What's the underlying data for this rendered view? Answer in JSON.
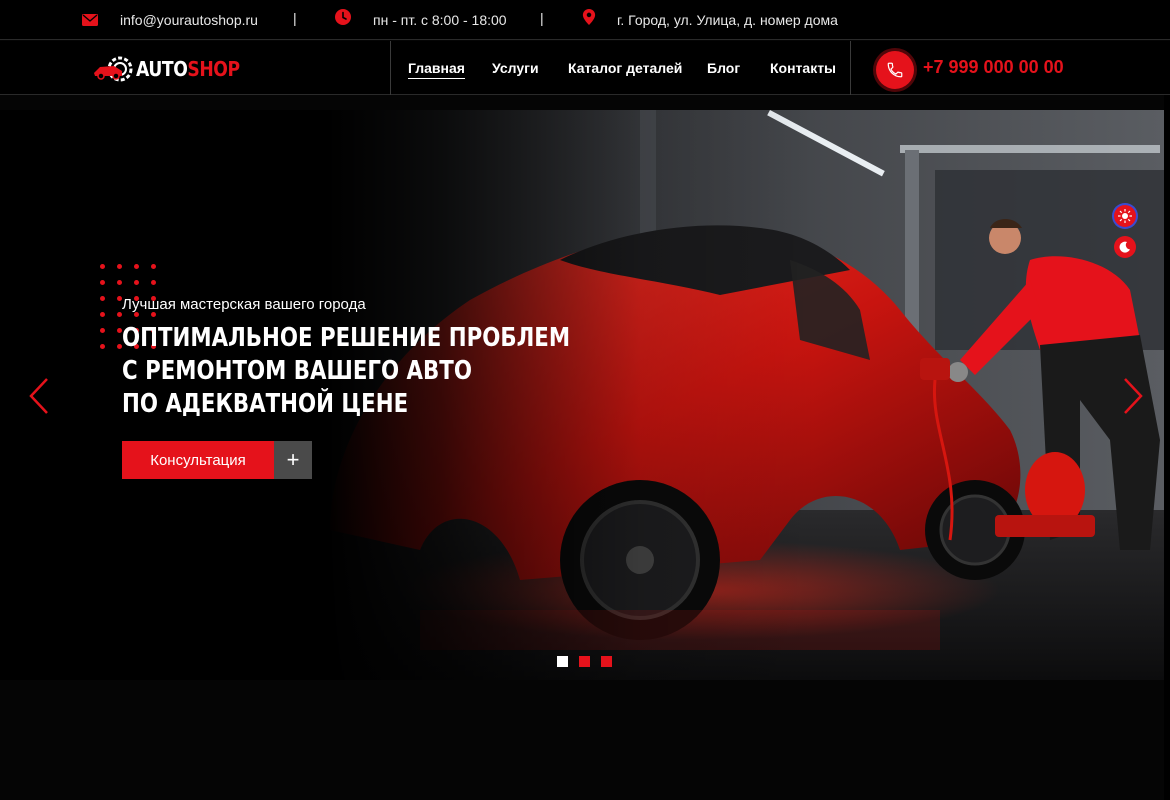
{
  "topbar": {
    "email": "info@yourautoshop.ru",
    "hours": "пн - пт. с 8:00 - 18:00",
    "address": "г. Город, ул. Улица, д. номер дома",
    "separator": "|",
    "icons": [
      "envelope-icon",
      "clock-icon",
      "location-pin-icon"
    ]
  },
  "logo": {
    "part1": "AUTO",
    "part2": "SHOP"
  },
  "nav": {
    "items": [
      {
        "label": "Главная",
        "active": true
      },
      {
        "label": "Услуги",
        "active": false
      },
      {
        "label": "Каталог деталей",
        "active": false
      },
      {
        "label": "Блог",
        "active": false
      },
      {
        "label": "Контакты",
        "active": false
      }
    ],
    "phone": "+7 999 000 00 00"
  },
  "hero": {
    "subtitle": "Лучшая мастерская вашего города",
    "title_lines": [
      "Оптимальное решение проблем",
      "с ремонтом вашего авто",
      "по адекватной цене"
    ],
    "cta_label": "Консультация",
    "cta_plus": "+",
    "slides": {
      "count": 3,
      "active_index": 0
    }
  },
  "colors": {
    "accent": "#e5121b",
    "background": "#000000",
    "cta_secondary": "#4a4a4a"
  }
}
